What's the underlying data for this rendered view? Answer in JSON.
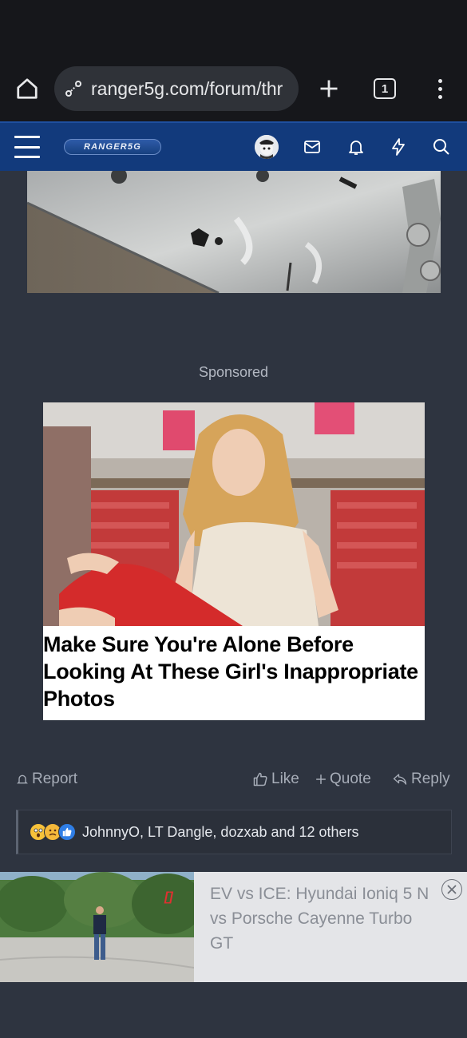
{
  "browser": {
    "url": "ranger5g.com/forum/thr",
    "tab_count": "1"
  },
  "site": {
    "logo_text": "RANGER5G"
  },
  "post": {
    "sponsored_label": "Sponsored"
  },
  "ad": {
    "headline": "Make Sure You're Alone Before Looking At These Girl's Inappropriate Photos"
  },
  "actions": {
    "report": "Report",
    "like": "Like",
    "quote": "Quote",
    "reply": "Reply"
  },
  "reactions": {
    "text": "JohnnyO, LT Dangle, dozxab and 12 others",
    "emoji": [
      "wow-emoji",
      "confused-emoji",
      "like-emoji"
    ]
  },
  "video_ad": {
    "title": "EV vs ICE: Hyundai Ioniq 5 N vs Porsche Cayenne Turbo GT",
    "badge": "[]"
  },
  "colors": {
    "nav_blue": "#123a7c",
    "page_bg": "#2e3440",
    "chrome_bg": "#16171b"
  }
}
